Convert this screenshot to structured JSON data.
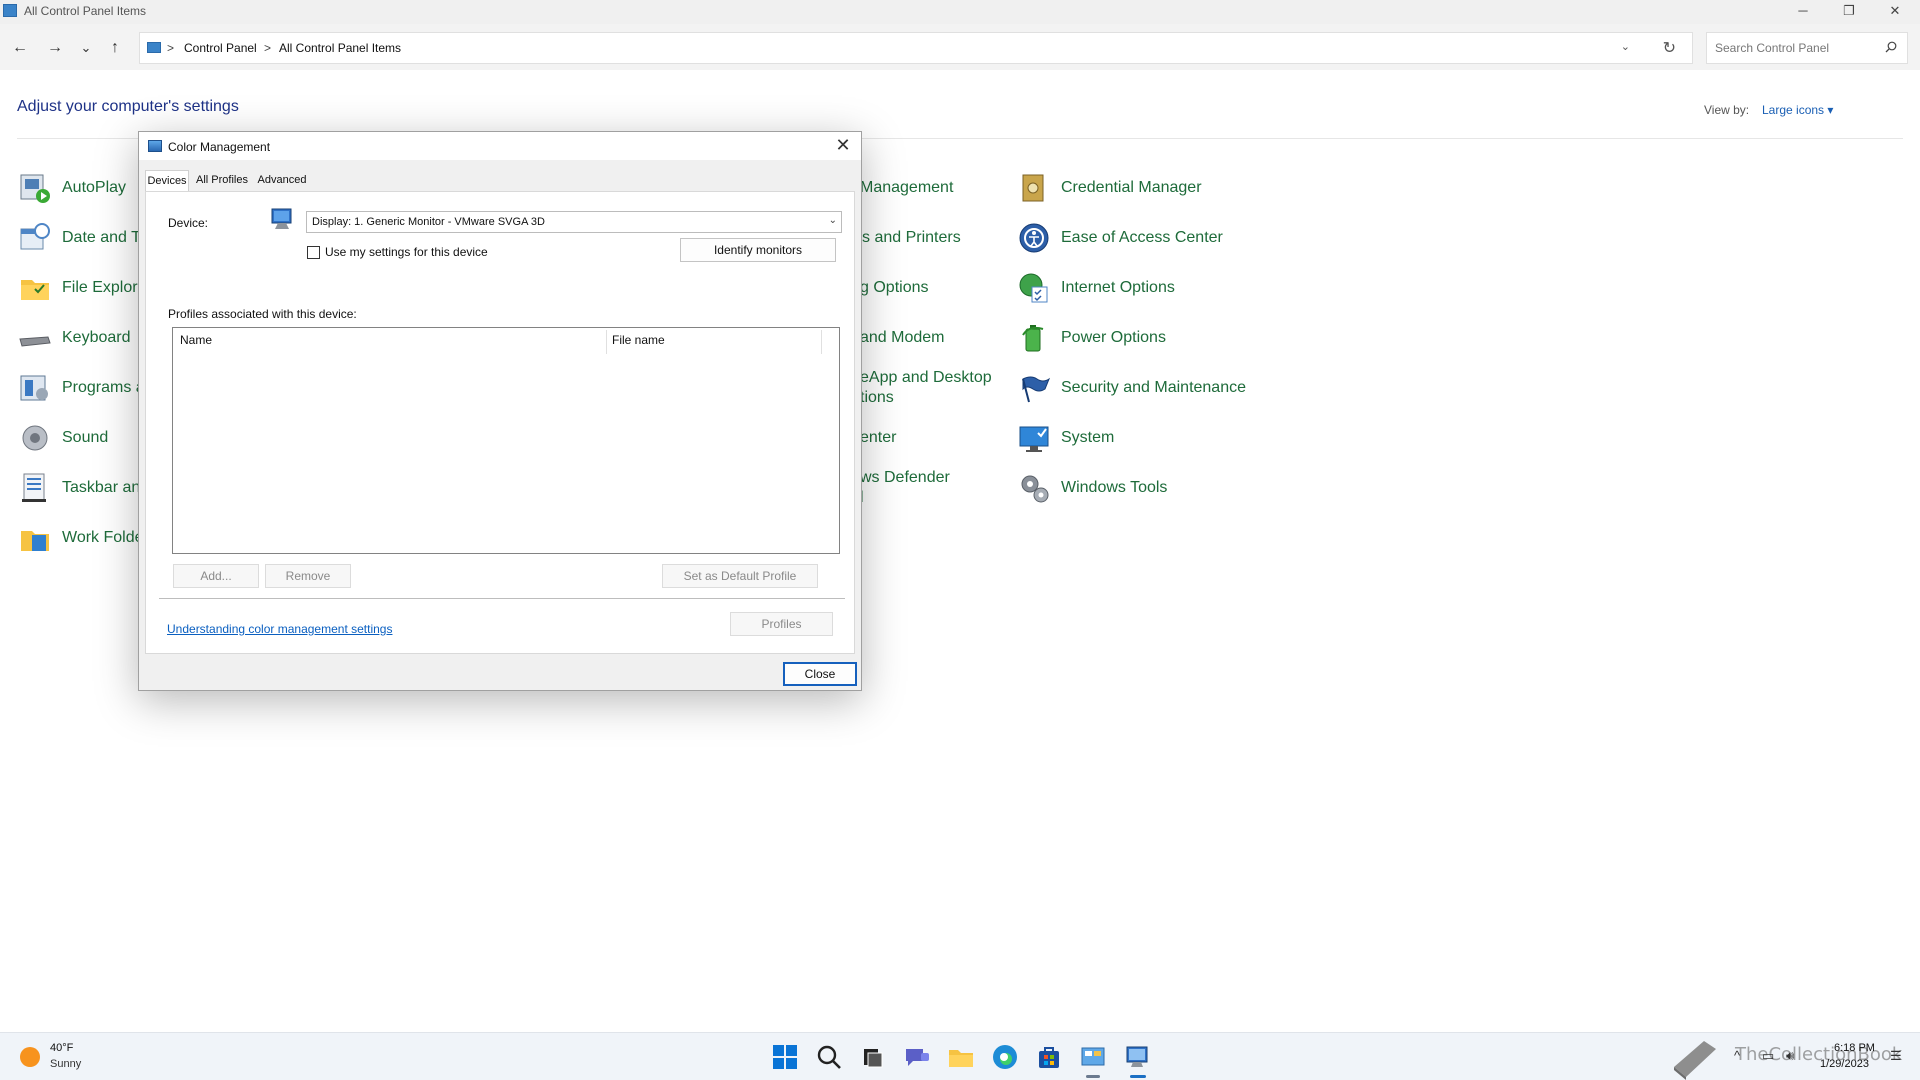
{
  "window": {
    "title": "All Control Panel Items",
    "controls": {
      "minimize": "─",
      "restore": "❐",
      "close": "✕"
    }
  },
  "nav": {
    "back": "←",
    "forward": "→",
    "recent": "⌄",
    "up": "↑",
    "breadcrumb": [
      "Control Panel",
      "All Control Panel Items"
    ],
    "separator": ">",
    "dropdown": "⌄",
    "refresh": "↻",
    "search_placeholder": "Search Control Panel"
  },
  "control_panel": {
    "heading": "Adjust your computer's settings",
    "view_by_label": "View by:",
    "view_by_value": "Large icons ▾",
    "items": {
      "autoplay": "AutoPlay",
      "date_time": "Date and Ti",
      "file_explorer": "File Explore",
      "keyboard": "Keyboard",
      "programs": "Programs a",
      "sound": "Sound",
      "taskbar": "Taskbar and",
      "work_folders": "Work Folde",
      "color_management": "Management",
      "devices_printers": "s and Printers",
      "indexing": "g Options",
      "phone_modem": "and Modem",
      "remoteapp_1": "eApp and Desktop",
      "remoteapp_2": "tions",
      "sync_center": "enter",
      "defender_1": "ws Defender",
      "defender_2": "l",
      "credential_manager": "Credential Manager",
      "ease_of_access": "Ease of Access Center",
      "internet_options": "Internet Options",
      "power_options": "Power Options",
      "security_maintenance": "Security and Maintenance",
      "system": "System",
      "windows_tools": "Windows Tools"
    }
  },
  "dialog": {
    "title": "Color Management",
    "close_x": "✕",
    "tabs": [
      "Devices",
      "All Profiles",
      "Advanced"
    ],
    "device_label": "Device:",
    "device_value": "Display: 1. Generic Monitor - VMware SVGA 3D",
    "use_my_settings": "Use my settings for this device",
    "identify_monitors": "Identify monitors",
    "profiles_label": "Profiles associated with this device:",
    "columns": [
      "Name",
      "File name"
    ],
    "add": "Add...",
    "remove": "Remove",
    "set_default": "Set as Default Profile",
    "link": "Understanding color management settings",
    "profiles_btn": "Profiles",
    "close_btn": "Close"
  },
  "taskbar": {
    "temp": "40°F",
    "condition": "Sunny",
    "time": "6:18 PM",
    "date": "1/29/2023",
    "watermark": "TheCollectionBook"
  }
}
